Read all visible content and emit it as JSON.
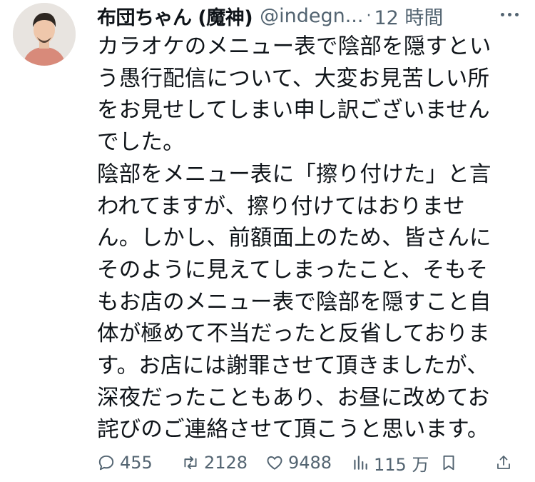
{
  "tweet": {
    "author_name": "布団ちゃん (魔神)",
    "handle": "@indegn...",
    "separator": "·",
    "time": "12 時間",
    "body_lines": [
      "カラオケのメニュー表で陰部を隠すとい",
      "う愚行配信について、大変お見苦しい所",
      "をお見せしてしまい申し訳ございません",
      "でした。",
      "陰部をメニュー表に「擦り付けた」と言",
      "われてますが、擦り付けてはおりませ",
      "ん。しかし、前額面上のため、皆さんに",
      "そのように見えてしまったこと、そもそ",
      "もお店のメニュー表で陰部を隠すこと自",
      "体が極めて不当だったと反省しておりま",
      "す。お店には謝罪させて頂きましたが、",
      "深夜だったこともあり、お昼に改めてお",
      "詫びのご連絡させて頂こうと思います。"
    ]
  },
  "actions": {
    "replies": "455",
    "reposts": "2128",
    "likes": "9488",
    "views": "115 万"
  },
  "icons": {
    "more": "more-horizontal-icon",
    "reply": "reply-bubble-icon",
    "repost": "repost-icon",
    "like": "heart-icon",
    "views": "bar-chart-icon",
    "bookmark": "bookmark-icon",
    "share": "share-icon"
  },
  "colors": {
    "text": "#0f1419",
    "muted": "#536471"
  }
}
